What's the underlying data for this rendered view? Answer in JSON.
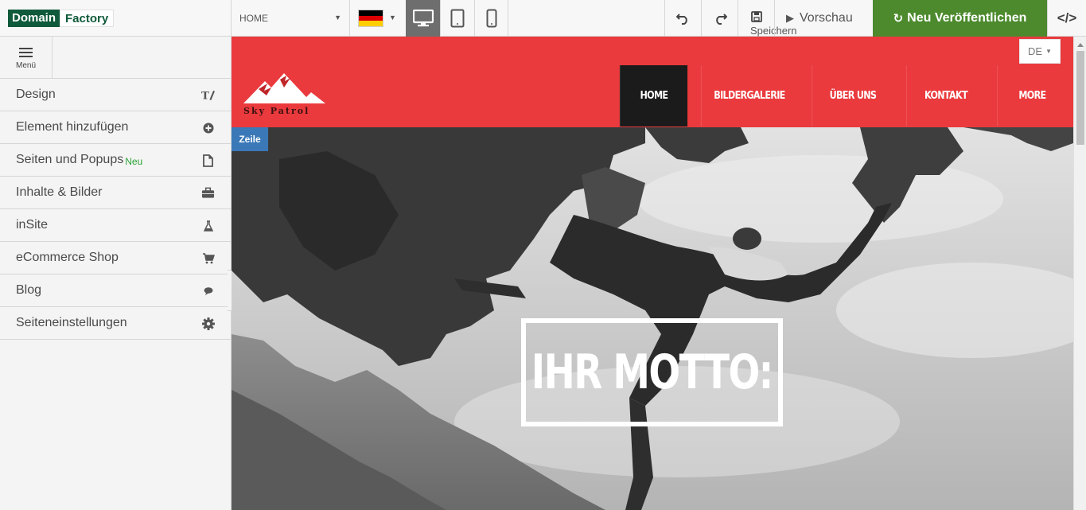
{
  "brand": {
    "part1": "Domain",
    "part2": "Factory"
  },
  "toolbar": {
    "page_select": "HOME",
    "language_flag": "germany-flag",
    "devices": [
      "desktop",
      "tablet",
      "mobile"
    ],
    "active_device": "desktop",
    "save_label": "Speichern",
    "preview_label": "Vorschau",
    "publish_label": "Neu Veröffentlichen",
    "code_label": "</>",
    "publish_color": "#4c8a2d"
  },
  "sidebar": {
    "menu_label": "Menü",
    "items": [
      {
        "label": "Design",
        "icon": "design-icon",
        "badge": ""
      },
      {
        "label": "Element hinzufügen",
        "icon": "plus-circle-icon",
        "badge": ""
      },
      {
        "label": "Seiten und Popups",
        "icon": "page-icon",
        "badge": "Neu"
      },
      {
        "label": "Inhalte & Bilder",
        "icon": "briefcase-icon",
        "badge": ""
      },
      {
        "label": "inSite",
        "icon": "flask-icon",
        "badge": ""
      },
      {
        "label": "eCommerce Shop",
        "icon": "cart-icon",
        "badge": ""
      },
      {
        "label": "Blog",
        "icon": "comment-icon",
        "badge": ""
      },
      {
        "label": "Seiteneinstellungen",
        "icon": "gear-icon",
        "badge": ""
      }
    ]
  },
  "site": {
    "accent_color": "#ea3a3d",
    "language": "DE",
    "logo_text": "Sky Patrol",
    "nav": [
      {
        "label": "HOME",
        "active": true
      },
      {
        "label": "BILDERGALERIE",
        "active": false
      },
      {
        "label": "ÜBER UNS",
        "active": false
      },
      {
        "label": "KONTAKT",
        "active": false
      },
      {
        "label": "MORE",
        "active": false
      }
    ],
    "row_tag": "Zeile",
    "motto": "IHR MOTTO:"
  }
}
